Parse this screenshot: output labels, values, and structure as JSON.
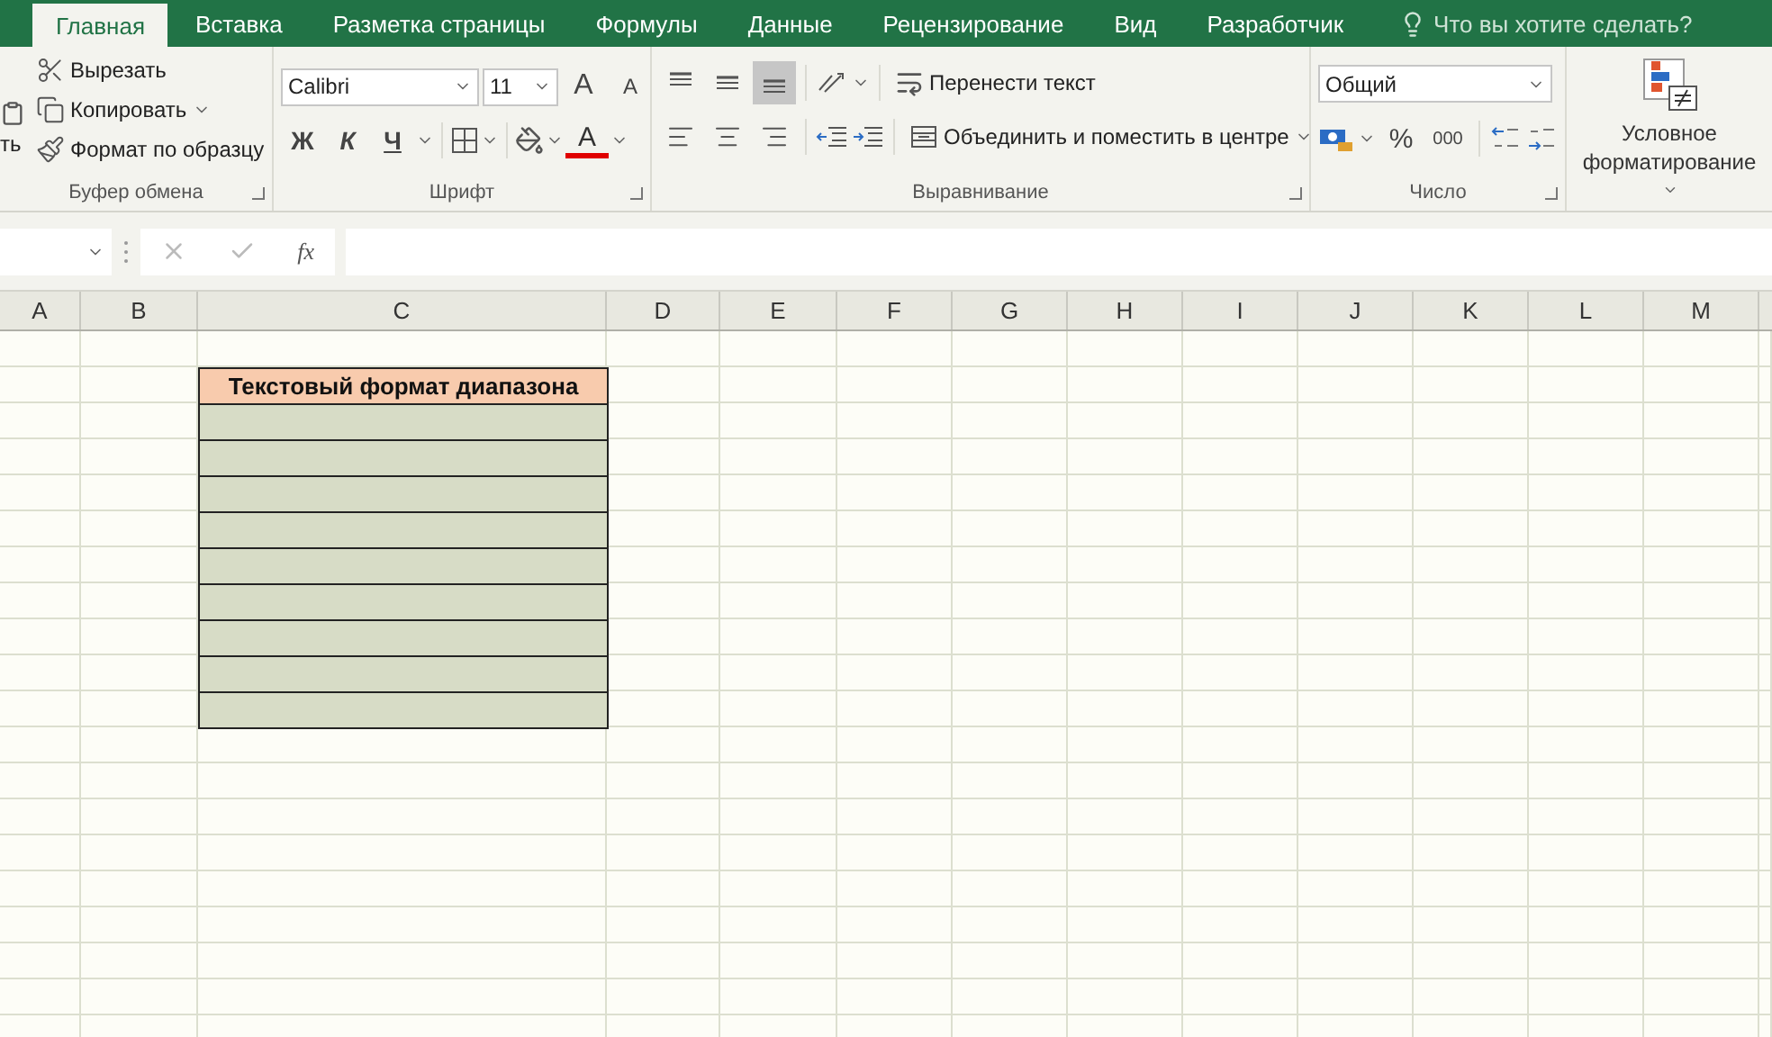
{
  "tabs": [
    {
      "label": "Главная",
      "selected": true
    },
    {
      "label": "Вставка",
      "selected": false
    },
    {
      "label": "Разметка страницы",
      "selected": false
    },
    {
      "label": "Формулы",
      "selected": false
    },
    {
      "label": "Данные",
      "selected": false
    },
    {
      "label": "Рецензирование",
      "selected": false
    },
    {
      "label": "Вид",
      "selected": false
    },
    {
      "label": "Разработчик",
      "selected": false
    }
  ],
  "tell_me": {
    "placeholder": "Что вы хотите сделать?"
  },
  "ribbon": {
    "clipboard": {
      "title": "Буфер обмена",
      "paste_label": "ть",
      "items": [
        {
          "label": "Вырезать",
          "kind": "cut",
          "menu": false
        },
        {
          "label": "Копировать",
          "kind": "copy",
          "menu": true
        },
        {
          "label": "Формат по образцу",
          "kind": "painter",
          "menu": false
        }
      ]
    },
    "font": {
      "title": "Шрифт",
      "font_name": "Calibri",
      "font_size": "11",
      "grow": "A",
      "shrink": "A",
      "bold": "Ж",
      "italic": "К",
      "underline": "Ч",
      "font_color_label": "A"
    },
    "alignment": {
      "title": "Выравнивание",
      "vertical": [
        {
          "kind": "top",
          "selected": false
        },
        {
          "kind": "middle",
          "selected": false
        },
        {
          "kind": "bottom",
          "selected": true
        }
      ],
      "horizontal": [
        {
          "kind": "left",
          "selected": false
        },
        {
          "kind": "center",
          "selected": false
        },
        {
          "kind": "right",
          "selected": false
        }
      ],
      "wrap": "Перенести текст",
      "merge": "Объединить и поместить в центре"
    },
    "number": {
      "title": "Число",
      "format": "Общий",
      "percent": "%",
      "thousands": "000"
    },
    "styles": {
      "conditional": "Условное форматирование"
    }
  },
  "formula_bar": {
    "fx": "fx"
  },
  "columns": [
    "A",
    "B",
    "C",
    "D",
    "E",
    "F",
    "G",
    "H",
    "I",
    "J",
    "K",
    "L",
    "M"
  ],
  "table": {
    "header": "Текстовый формат диапазона"
  }
}
